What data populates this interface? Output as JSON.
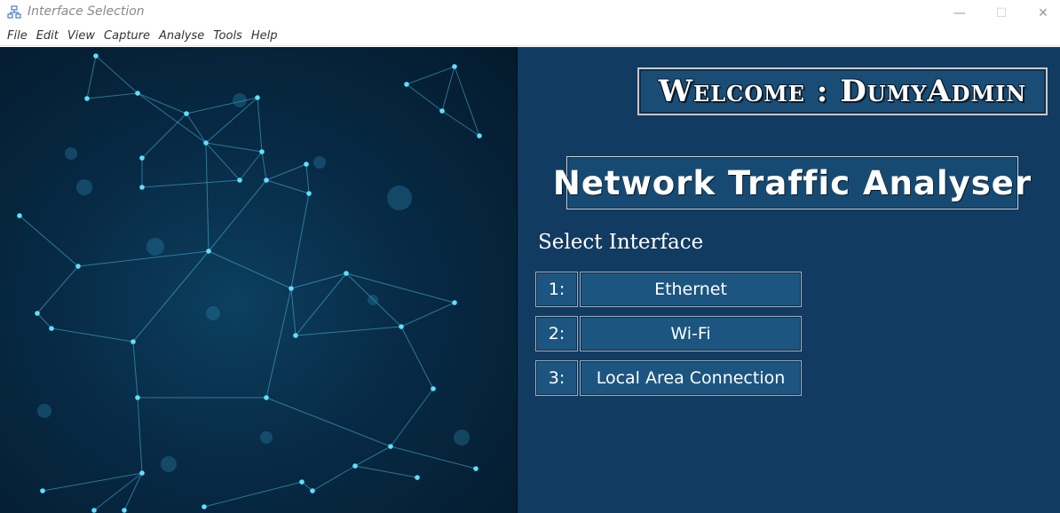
{
  "window": {
    "title": "Interface Selection",
    "minimize_glyph": "—",
    "maximize_glyph": "☐",
    "close_glyph": "✕"
  },
  "menu": {
    "items": [
      "File",
      "Edit",
      "View",
      "Capture",
      "Analyse",
      "Tools",
      "Help"
    ]
  },
  "main": {
    "welcome": "Welcome : DumyAdmin",
    "app_title": "Network Traffic Analyser",
    "select_label": "Select Interface",
    "interfaces": [
      {
        "num": "1:",
        "name": "Ethernet"
      },
      {
        "num": "2:",
        "name": "Wi-Fi"
      },
      {
        "num": "3:",
        "name": "Local Area Connection"
      }
    ]
  },
  "colors": {
    "panel_bg": "#123b62",
    "button_bg": "#1c5580",
    "network_node": "#5fe0ff"
  }
}
